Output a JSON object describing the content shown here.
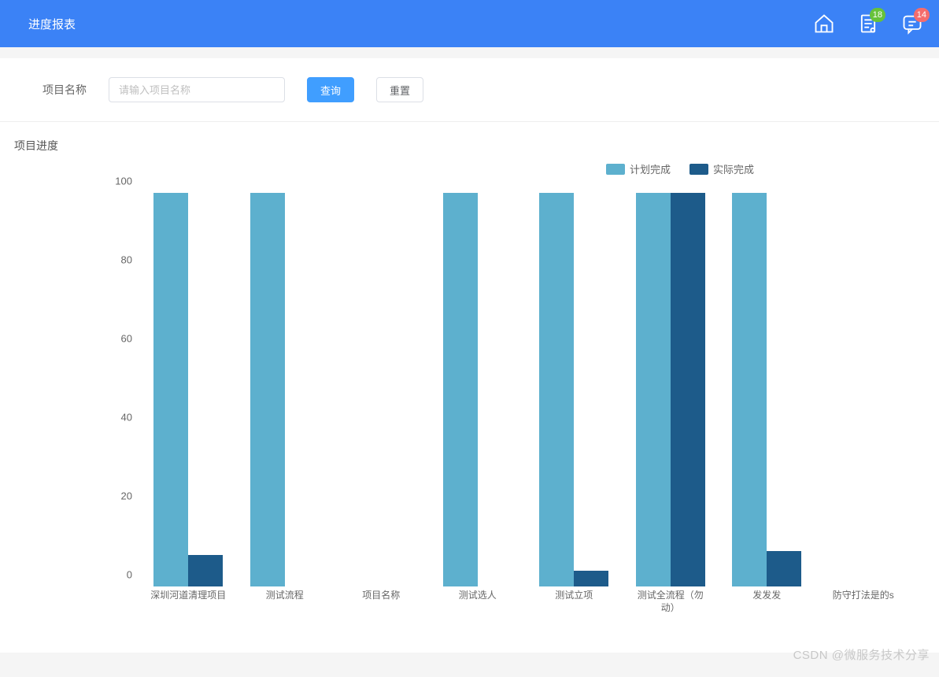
{
  "header": {
    "title": "进度报表",
    "badge_green": "18",
    "badge_red": "14"
  },
  "filter": {
    "label": "项目名称",
    "placeholder": "请输入项目名称",
    "query_btn": "查询",
    "reset_btn": "重置"
  },
  "chart": {
    "title": "项目进度",
    "legend_plan": "计划完成",
    "legend_actual": "实际完成"
  },
  "chart_data": {
    "type": "bar",
    "categories": [
      "深圳河道清理项目",
      "测试流程",
      "项目名称",
      "测试选人",
      "测试立项",
      "测试全流程（勿动）",
      "发发发",
      "防守打法是的s"
    ],
    "series": [
      {
        "name": "计划完成",
        "color": "#5db0ce",
        "values": [
          100,
          100,
          0,
          100,
          100,
          100,
          100,
          0
        ]
      },
      {
        "name": "实际完成",
        "color": "#1d5b8a",
        "values": [
          8,
          0,
          0,
          0,
          4,
          100,
          9,
          0
        ]
      }
    ],
    "title": "项目进度",
    "xlabel": "",
    "ylabel": "",
    "ylim": [
      0,
      100
    ],
    "yticks": [
      0,
      20,
      40,
      60,
      80,
      100
    ]
  },
  "watermark": "CSDN @微服务技术分享"
}
